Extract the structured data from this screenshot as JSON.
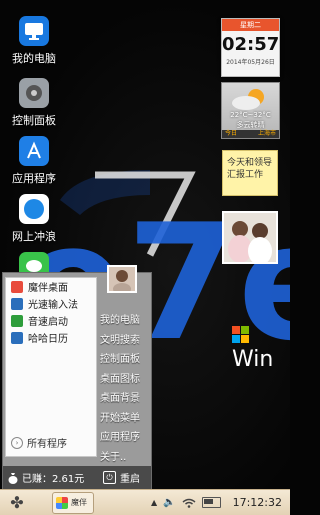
{
  "desktop": {
    "icons": [
      {
        "label": "我的电脑",
        "icon": "computer-icon",
        "color": "#1878e0"
      },
      {
        "label": "控制面板",
        "icon": "control-panel-icon",
        "color": "#9aa0a6"
      },
      {
        "label": "应用程序",
        "icon": "app-store-icon",
        "color": "#1f7fe6"
      },
      {
        "label": "网上冲浪",
        "icon": "safari-compass-icon",
        "color": "#1e88e5"
      },
      {
        "label": "",
        "icon": "messages-icon",
        "color": "#39c34a"
      }
    ],
    "big_text": "e7en",
    "win_text": "Win"
  },
  "calendar": {
    "weekday": "星期二",
    "time": "02:57",
    "date": "2014年05月26日"
  },
  "weather": {
    "temp": "22°C~32°C",
    "desc": "多云转晴",
    "day": "今日",
    "city": "上海市"
  },
  "note": {
    "text": "今天和领导汇报工作"
  },
  "start_menu": {
    "left_items": [
      {
        "label": "魔伴桌面",
        "icon": "mobanzhuomian-icon",
        "color": "#e84b3c"
      },
      {
        "label": "光速输入法",
        "icon": "input-method-icon",
        "color": "#2a6ebb"
      },
      {
        "label": "音速启动",
        "icon": "launcher-icon",
        "color": "#2e9d3b"
      },
      {
        "label": "哈哈日历",
        "icon": "calendar-app-icon",
        "color": "#2a6ebb"
      }
    ],
    "all_programs": "所有程序",
    "right_items": [
      "我的电脑",
      "文明搜索",
      "控制面板",
      "桌面图标",
      "桌面背景",
      "开始菜单",
      "应用程序",
      "关于.."
    ],
    "earnings": "已赚：2.61元",
    "reboot": "重启"
  },
  "taskbar": {
    "task_label": "魔伴",
    "clock": "17:12:32"
  }
}
